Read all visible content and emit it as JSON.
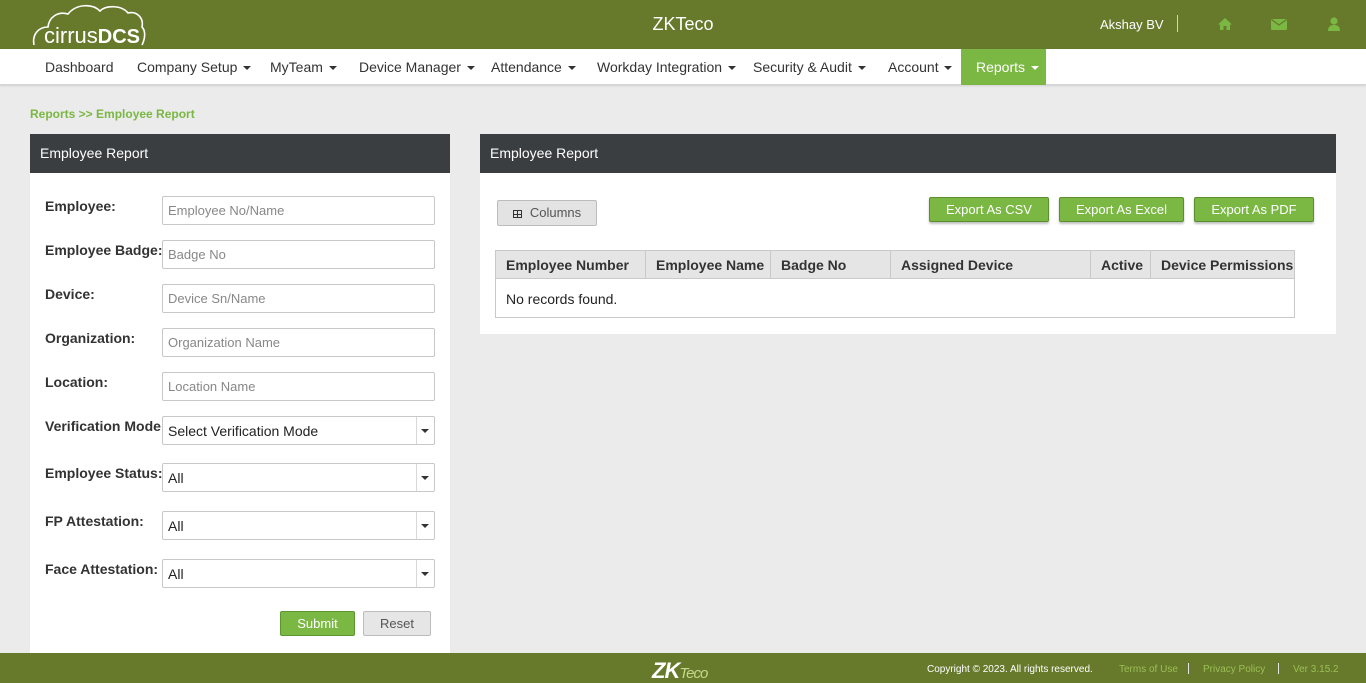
{
  "header": {
    "logo_text": "cirrus",
    "logo_text_bold": "DCS",
    "title": "ZKTeco",
    "user_name": "Akshay BV",
    "icons": [
      "home-icon",
      "envelope-icon",
      "user-icon"
    ]
  },
  "nav": {
    "items": [
      {
        "label": "Dashboard",
        "dropdown": false
      },
      {
        "label": "Company Setup",
        "dropdown": true
      },
      {
        "label": "MyTeam",
        "dropdown": true
      },
      {
        "label": "Device Manager",
        "dropdown": true
      },
      {
        "label": "Attendance",
        "dropdown": true
      },
      {
        "label": "Workday Integration",
        "dropdown": true
      },
      {
        "label": "Security & Audit",
        "dropdown": true
      },
      {
        "label": "Account",
        "dropdown": true
      },
      {
        "label": "Reports",
        "dropdown": true,
        "active": true
      }
    ]
  },
  "breadcrumb": "Reports >> Employee Report",
  "filter_panel": {
    "title": "Employee Report",
    "fields": [
      {
        "label": "Employee:",
        "placeholder": "Employee No/Name"
      },
      {
        "label": "Employee Badge:",
        "placeholder": "Badge No"
      },
      {
        "label": "Device:",
        "placeholder": "Device Sn/Name"
      },
      {
        "label": "Organization:",
        "placeholder": "Organization Name"
      },
      {
        "label": "Location:",
        "placeholder": "Location Name"
      }
    ],
    "selects": [
      {
        "label": "Verification Mode:",
        "value": "Select Verification Mode"
      },
      {
        "label": "Employee Status:",
        "value": "All"
      },
      {
        "label": "FP Attestation:",
        "value": "All"
      },
      {
        "label": "Face Attestation:",
        "value": "All"
      }
    ],
    "submit_label": "Submit",
    "reset_label": "Reset"
  },
  "results_panel": {
    "title": "Employee Report",
    "columns_button": "Columns",
    "export_csv": "Export As CSV",
    "export_excel": "Export As Excel",
    "export_pdf": "Export As PDF",
    "table_headers": [
      "Employee Number",
      "Employee Name",
      "Badge No",
      "Assigned Device",
      "Active",
      "Device Permissions"
    ],
    "empty_message": "No records found."
  },
  "footer": {
    "logo": "ZK",
    "logo_suffix": "Teco",
    "copyright": "Copyright © 2023. All rights reserved.",
    "terms": "Terms of Use",
    "privacy": "Privacy Policy",
    "version": "Ver 3.15.2"
  },
  "colors": {
    "header_bg": "#677a2c",
    "accent_green": "#7ab743",
    "panel_head": "#3b3e40"
  }
}
